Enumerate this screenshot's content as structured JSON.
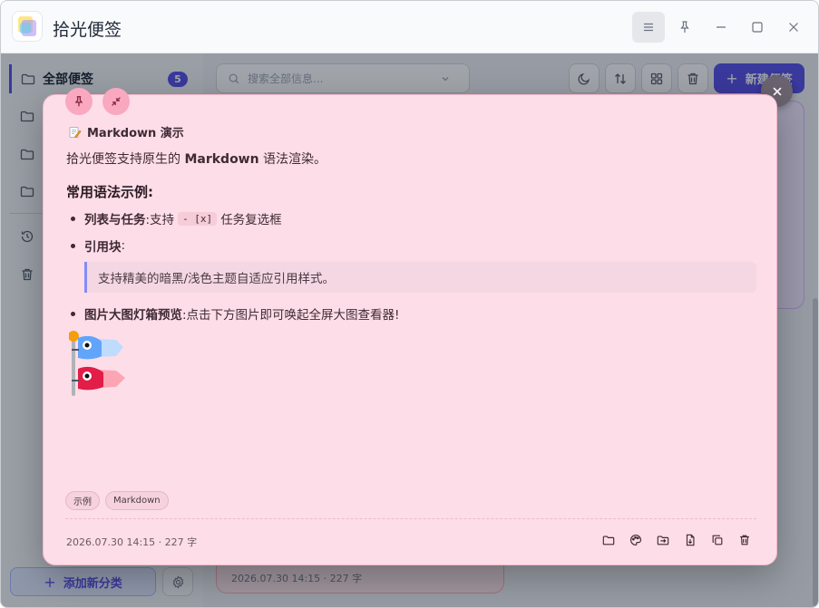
{
  "app": {
    "title": "拾光便签"
  },
  "sidebar": {
    "active_item": {
      "label": "全部便签",
      "count": "5"
    },
    "items": [
      "",
      "",
      "",
      ""
    ],
    "add_category_label": "添加新分类"
  },
  "toolbar": {
    "search_placeholder": "搜索全部信息...",
    "new_note_label": "新建便签"
  },
  "background_card": {
    "meta": "2026.07.30 14:15 · 227 字"
  },
  "note": {
    "title": "Markdown 演示",
    "intro_prefix": "拾光便签支持原生的 ",
    "intro_bold": "Markdown",
    "intro_suffix": " 语法渲染。",
    "heading": "常用语法示例:",
    "list": [
      {
        "bold": "列表与任务",
        "text": ":支持",
        "code": "- [x]",
        "after": "任务复选框"
      },
      {
        "bold": "引用块",
        "text": ":"
      },
      {
        "bold": "图片大图灯箱预览",
        "text": ":点击下方图片即可唤起全屏大图查看器!"
      }
    ],
    "quote": "支持精美的暗黑/浅色主题自适应引用样式。",
    "tags": [
      "示例",
      "Markdown"
    ],
    "meta": "2026.07.30 14:15 · 227 字"
  },
  "colors": {
    "accent": "#4f46e5",
    "note_bg": "#fddde8",
    "quote_border": "#818cf8"
  },
  "icons": {
    "titlebar": [
      "menu-icon",
      "pin-icon",
      "minimize-icon",
      "maximize-icon",
      "close-icon"
    ],
    "toolbar": [
      "moon-icon",
      "sort-icon",
      "grid-icon",
      "trash-icon"
    ],
    "note_footer": [
      "folder-icon",
      "palette-icon",
      "move-folder-icon",
      "export-file-icon",
      "copy-icon",
      "trash-icon"
    ]
  }
}
